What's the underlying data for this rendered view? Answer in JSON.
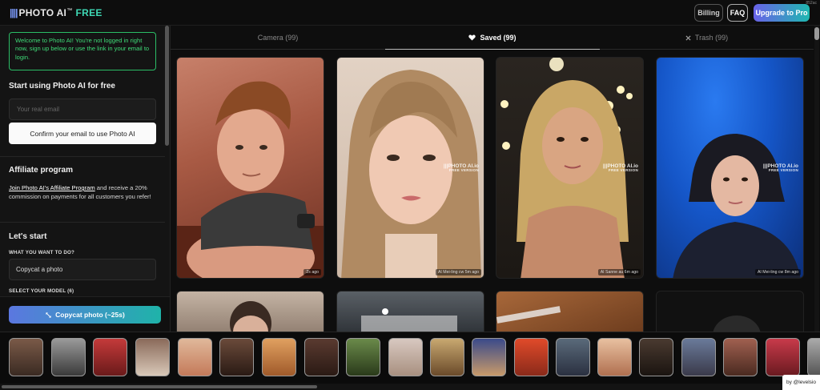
{
  "header": {
    "logo_bars": "||||",
    "logo_photo": "PHOTO AI",
    "logo_tm": "™",
    "logo_free": "FREE",
    "corner_text": "852ac",
    "billing_label": "Billing",
    "faq_label": "FAQ",
    "upgrade_label": "Upgrade to Pro"
  },
  "sidebar": {
    "notice": "Welcome to Photo AI! You're not logged in right now, sign up below or use the link in your email to login.",
    "start_heading": "Start using Photo AI for free",
    "email_placeholder": "Your real email",
    "confirm_label": "Confirm your email to use Photo AI",
    "affiliate_heading": "Affiliate program",
    "affiliate_link": "Join Photo AI's Affiliate Program",
    "affiliate_text": " and receive a 20% commission on payments for all customers you refer!",
    "lets_start_heading": "Let's start",
    "want_label": "WHAT YOU WANT TO DO?",
    "selected_action": "Copycat a photo",
    "model_label": "SELECT YOUR MODEL (6)",
    "copycat_button": "Copycat photo (~25s)",
    "copycat_icon": "camera-swap-icon"
  },
  "tabs": [
    {
      "label": "Camera (99)",
      "icon": "",
      "active": false
    },
    {
      "label": "Saved (99)",
      "icon": "heart-icon",
      "active": true
    },
    {
      "label": "Trash (99)",
      "icon": "close-icon",
      "active": false
    }
  ],
  "gallery": {
    "watermark_main": "|||PHOTO AI.io",
    "watermark_sub": "FREE VERSION",
    "cards": [
      {
        "credit": "2s ago",
        "has_watermark": false,
        "subject": "man with hand on chin"
      },
      {
        "credit": "AI Mei-ling cw 5m ago",
        "has_watermark": true,
        "subject": "woman with long brown hair"
      },
      {
        "credit": "AI Sanne au 6m ago",
        "has_watermark": true,
        "subject": "blonde woman bokeh lights"
      },
      {
        "credit": "AI Mei-ling cw 8m ago",
        "has_watermark": true,
        "subject": "woman on blue background"
      }
    ]
  },
  "footer": {
    "byline": "by @levelsio"
  }
}
